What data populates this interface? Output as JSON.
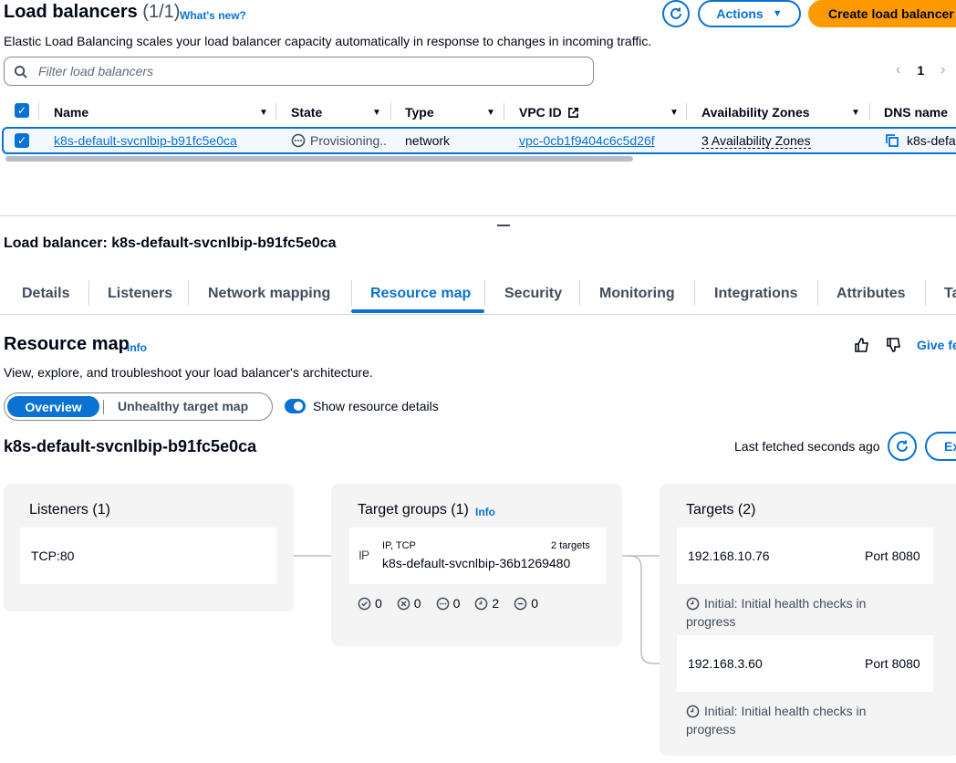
{
  "header": {
    "title": "Load balancers",
    "count": "(1/1)",
    "whats_new": "What's new?",
    "actions_label": "Actions",
    "create_label": "Create load balancer",
    "subtitle": "Elastic Load Balancing scales your load balancer capacity automatically in response to changes in incoming traffic."
  },
  "filter": {
    "placeholder": "Filter load balancers"
  },
  "pagination": {
    "page": "1"
  },
  "table": {
    "columns": [
      "Name",
      "State",
      "Type",
      "VPC ID",
      "Availability Zones",
      "DNS name"
    ],
    "rows": [
      {
        "name": "k8s-default-svcnlbip-b91fc5e0ca",
        "state": "Provisioning..",
        "type": "network",
        "vpc_id": "vpc-0cb1f9404c6c5d26f",
        "availability_zones": "3 Availability Zones",
        "dns_name": "k8s-defa"
      }
    ]
  },
  "detail": {
    "title": "Load balancer: k8s-default-svcnlbip-b91fc5e0ca",
    "tabs": [
      "Details",
      "Listeners",
      "Network mapping",
      "Resource map",
      "Security",
      "Monitoring",
      "Integrations",
      "Attributes",
      "Ta"
    ],
    "active_tab": "Resource map"
  },
  "resource_map": {
    "title": "Resource map",
    "info": "Info",
    "give_feedback": "Give fe",
    "description": "View, explore, and troubleshoot your load balancer's architecture.",
    "segments": [
      "Overview",
      "Unhealthy target map"
    ],
    "toggle_label": "Show resource details",
    "lb_name": "k8s-default-svcnlbip-b91fc5e0ca",
    "last_fetched": "Last fetched seconds ago",
    "export_label": "Ex",
    "listeners": {
      "title": "Listeners (1)",
      "items": [
        "TCP:80"
      ]
    },
    "target_groups": {
      "title": "Target groups (1)",
      "info": "Info",
      "item": {
        "protocol": "IP, TCP",
        "targets": "2 targets",
        "name": "k8s-default-svcnlbip-36b1269480",
        "type_icon": "IP"
      },
      "status_counts": [
        "0",
        "0",
        "0",
        "2",
        "0"
      ]
    },
    "targets": {
      "title": "Targets (2)",
      "items": [
        {
          "ip": "192.168.10.76",
          "port": "Port 8080",
          "health": "Initial: Initial health checks in progress"
        },
        {
          "ip": "192.168.3.60",
          "port": "Port 8080",
          "health": "Initial: Initial health checks in progress"
        }
      ]
    }
  },
  "colors": {
    "accent": "#0972d3",
    "primary_button": "#ff9900",
    "panel": "#f4f4f4"
  }
}
